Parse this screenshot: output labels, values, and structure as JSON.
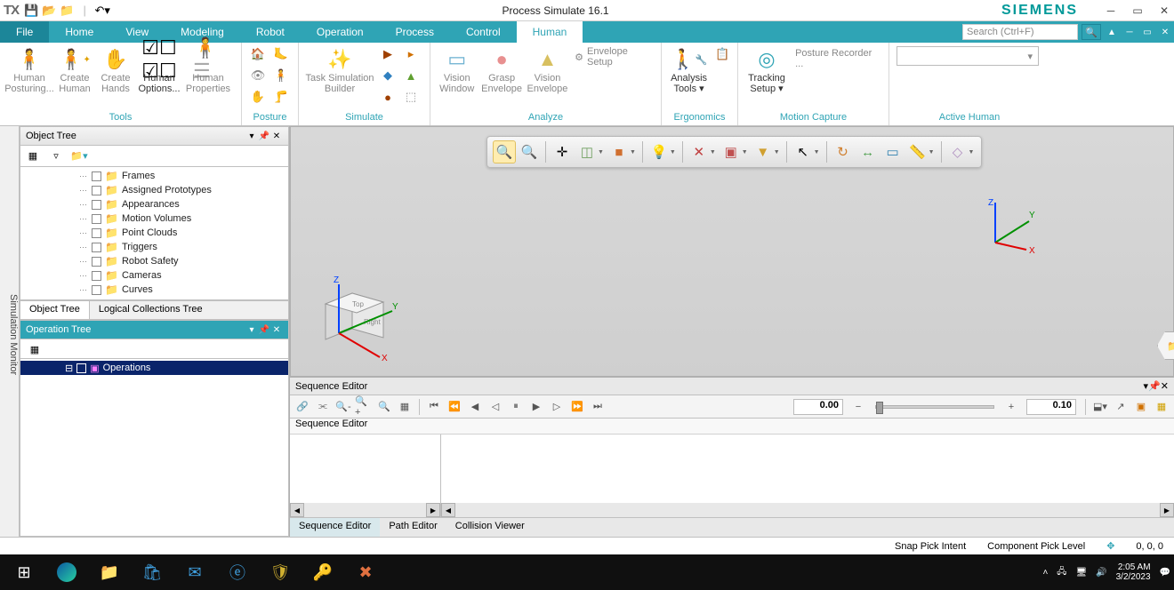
{
  "title": "Process Simulate 16.1",
  "brand": "SIEMENS",
  "search_placeholder": "Search (Ctrl+F)",
  "tabs": {
    "file": "File",
    "home": "Home",
    "view": "View",
    "modeling": "Modeling",
    "robot": "Robot",
    "operation": "Operation",
    "process": "Process",
    "control": "Control",
    "human": "Human"
  },
  "ribbon": {
    "tools": {
      "label": "Tools",
      "human_posturing": "Human\nPosturing...",
      "create_human": "Create\nHuman",
      "create_hands": "Create\nHands",
      "human_options": "Human\nOptions...",
      "human_properties": "Human\nProperties"
    },
    "posture": {
      "label": "Posture"
    },
    "simulate": {
      "label": "Simulate",
      "tsb": "Task Simulation\nBuilder"
    },
    "analyze": {
      "label": "Analyze",
      "vision_window": "Vision\nWindow",
      "grasp_envelope": "Grasp\nEnvelope",
      "vision_envelope": "Vision\nEnvelope",
      "envelope_setup": "Envelope Setup"
    },
    "ergonomics": {
      "label": "Ergonomics",
      "analysis_tools": "Analysis\nTools ▾"
    },
    "motion_capture": {
      "label": "Motion Capture",
      "tracking_setup": "Tracking\nSetup ▾",
      "posture_recorder": "Posture Recorder ..."
    },
    "active_human": {
      "label": "Active Human"
    }
  },
  "sim_monitor": "Simulation Monitor",
  "object_tree": {
    "title": "Object Tree",
    "items": [
      "Frames",
      "Assigned Prototypes",
      "Appearances",
      "Motion Volumes",
      "Point Clouds",
      "Triggers",
      "Robot Safety",
      "Cameras",
      "Curves"
    ],
    "tab1": "Object Tree",
    "tab2": "Logical Collections Tree"
  },
  "operation_tree": {
    "title": "Operation Tree",
    "root": "Operations"
  },
  "sequence": {
    "title": "Sequence Editor",
    "sub": "Sequence Editor",
    "time": "0.00",
    "step": "0.10",
    "tabs": [
      "Sequence Editor",
      "Path Editor",
      "Collision Viewer"
    ]
  },
  "status": {
    "snap": "Snap Pick Intent",
    "component": "Component Pick Level",
    "coords": "0, 0, 0"
  },
  "clock": {
    "time": "2:05 AM",
    "date": "3/2/2023"
  }
}
